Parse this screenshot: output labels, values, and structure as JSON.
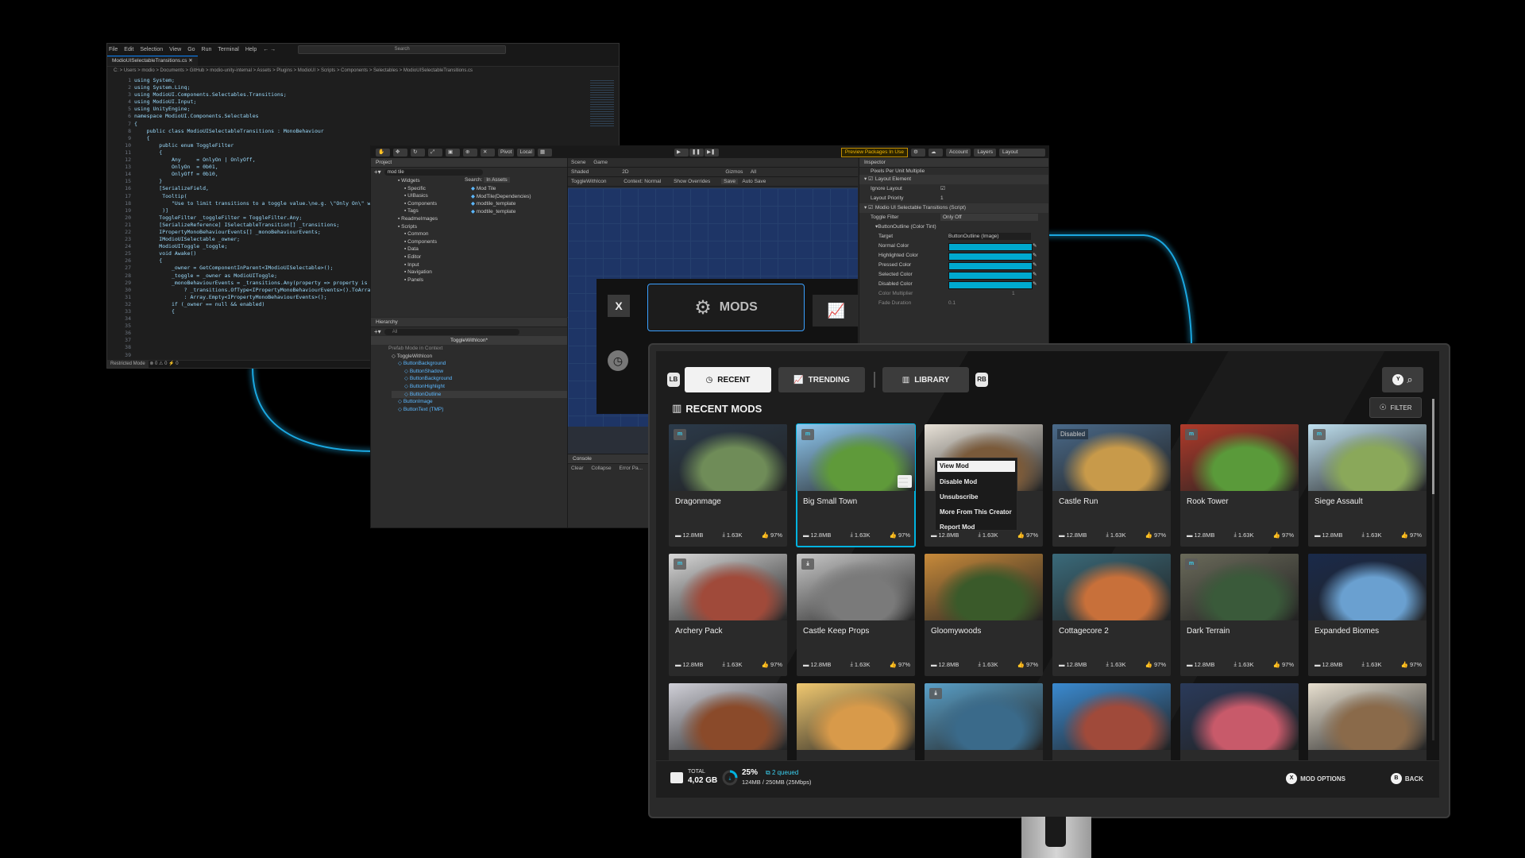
{
  "colors": {
    "glow": "#1aa7e0",
    "accent": "#00b3e0",
    "tile_bg": "#2a2a2a",
    "unity_cyan": "#00a9cf",
    "preview_orange": "#f0b400"
  },
  "code_editor": {
    "menu": [
      "File",
      "Edit",
      "Selection",
      "View",
      "Go",
      "Run",
      "Terminal",
      "Help"
    ],
    "search_placeholder": "Search",
    "tab": "ModioUISelectableTransitions.cs",
    "breadcrumb": "C: > Users > modio > Documents > GitHub > modio-unity-internal > Assets > Plugins > ModioUI > Scripts > Components > Selectables > ModioUISelectableTransitions.cs",
    "lines": [
      "using System;",
      "using System.Linq;",
      "using ModioUI.Components.Selectables.Transitions;",
      "using ModioUI.Input;",
      "using UnityEngine;",
      "",
      "namespace ModioUI.Components.Selectables",
      "{",
      "    public class ModioUISelectableTransitions : MonoBehaviour",
      "    {",
      "        public enum ToggleFilter",
      "        {",
      "            Any     = OnlyOn | OnlyOff,",
      "            OnlyOn  = 0b01,",
      "            OnlyOff = 0b10,",
      "        }",
      "",
      "        [SerializeField,",
      "         Tooltip(",
      "            \"Use to limit transitions to a toggle value.\\ne.g. \\\"Only On\\\" will ...",
      "         )]",
      "        ToggleFilter _toggleFilter = ToggleFilter.Any;",
      "        [SerializeReference] ISelectableTransition[] _transitions;",
      "        IPropertyMonoBehaviourEvents[] _monoBehaviourEvents;",
      "",
      "        IModioUISelectable _owner;",
      "        ModioUIToggle _toggle;",
      "",
      "        void Awake()",
      "        {",
      "            _owner = GetComponentInParent<IModioUISelectable>();",
      "            _toggle = _owner as ModioUIToggle;",
      "",
      "            _monoBehaviourEvents = _transitions.Any(property => property is IProp...",
      "                ? _transitions.OfType<IPropertyMonoBehaviourEvents>().ToArray()",
      "                : Array.Empty<IPropertyMonoBehaviourEvents>();",
      "",
      "            if (_owner == null && enabled)",
      "            {"
    ],
    "status_mode": "Restricted Mode",
    "status_counts": "⊗ 0 ⚠ 0   ⚡ 0"
  },
  "unity": {
    "toolbar": {
      "pivot": "Pivot",
      "local": "Local",
      "preview": "Preview Packages In Use",
      "account": "Account",
      "layers": "Layers",
      "layout": "Layout"
    },
    "project": {
      "title": "Project",
      "search_value": "mod tile",
      "search_label": "Search:",
      "search_scope": "In Assets",
      "tree": [
        "Widgets",
        "Specific",
        "UIBasics",
        "Components",
        "Tags",
        "ReadmeImages",
        "Scripts",
        "Common",
        "Components",
        "Data",
        "Editor",
        "Input",
        "Navigation",
        "Panels"
      ],
      "results": [
        "Mod Tile",
        "ModTile(Dependencies)",
        "modtile_template",
        "modtile_template"
      ]
    },
    "hierarchy": {
      "title": "Hierarchy",
      "search_placeholder": "All",
      "root": "ToggleWithIcon*",
      "context": "Prefab Mode in Context",
      "items": [
        "ToggleWithIcon",
        "ButtonBackground",
        "ButtonShadow",
        "ButtonBackground",
        "ButtonHighlight",
        "ButtonOutline",
        "ButtonImage",
        "ButtonText (TMP)"
      ]
    },
    "scene": {
      "tabs": [
        "Scene",
        "Game"
      ],
      "shading": "Shaded",
      "mode": "2D",
      "context_label": "Context:",
      "context_value": "Normal",
      "show_overrides": "Show Overrides",
      "save": "Save",
      "auto_save": "Auto Save",
      "gizmos": "Gizmos",
      "gizmo_search": "All",
      "prefab_name": "ToggleWithIcon",
      "mods_label": "MODS",
      "x_label": "X",
      "console_title": "Console",
      "console_clear": "Clear",
      "console_collapse": "Collapse",
      "console_error_pause": "Error Pa..."
    },
    "inspector": {
      "title": "Inspector",
      "top_field": "Pixels Per Unit Multiplie",
      "layout_element": "Layout Element",
      "ignore_layout": "Ignore Layout",
      "layout_priority": "Layout Priority",
      "layout_priority_value": "1",
      "script_component": "Modio UI Selectable Transitions (Script)",
      "toggle_filter": "Toggle Filter",
      "toggle_filter_value": "Only Off",
      "color_tint": "ButtonOutline (Color Tint)",
      "target": "Target",
      "target_value": "ButtonOutline (Image)",
      "colors": [
        "Normal Color",
        "Highlighted Color",
        "Pressed Color",
        "Selected Color",
        "Disabled Color"
      ],
      "color_multiplier": "Color Multiplier",
      "color_multiplier_value": "1",
      "fade_duration": "Fade Duration",
      "fade_duration_value": "0.1"
    }
  },
  "mod_browser": {
    "lb": "LB",
    "rb": "RB",
    "tabs": [
      {
        "label": "RECENT",
        "active": true,
        "icon": "clock-icon"
      },
      {
        "label": "TRENDING",
        "active": false,
        "icon": "trend-icon"
      },
      {
        "label": "LIBRARY",
        "active": false,
        "icon": "library-icon"
      }
    ],
    "search_key": "Y",
    "section_title": "RECENT MODS",
    "filter_label": "FILTER",
    "mods": [
      {
        "name": "Dragonmage",
        "size": "12.8MB",
        "downloads": "1.63K",
        "rating": "97%",
        "badge": "subscribed",
        "c1": "#2b3a4a",
        "c2": "#6f8c58"
      },
      {
        "name": "Big Small Town",
        "size": "12.8MB",
        "downloads": "1.63K",
        "rating": "97%",
        "badge": "subscribed",
        "selected": true,
        "c1": "#8fc8f0",
        "c2": "#5f9a3a"
      },
      {
        "name": "",
        "size": "12.8MB",
        "downloads": "1.63K",
        "rating": "97%",
        "badge": "none",
        "c1": "#e8e2d8",
        "c2": "#7a5a3a"
      },
      {
        "name": "Castle Run",
        "size": "12.8MB",
        "downloads": "1.63K",
        "rating": "97%",
        "badge": "disabled",
        "c1": "#4a6a8a",
        "c2": "#c89a4a"
      },
      {
        "name": "Rook Tower",
        "size": "12.8MB",
        "downloads": "1.63K",
        "rating": "97%",
        "badge": "subscribed",
        "c1": "#b03a2a",
        "c2": "#5a9a3a"
      },
      {
        "name": "Siege Assault",
        "size": "12.8MB",
        "downloads": "1.63K",
        "rating": "97%",
        "badge": "subscribed",
        "c1": "#bfe0f0",
        "c2": "#8aa85a"
      },
      {
        "name": "Archery Pack",
        "size": "12.8MB",
        "downloads": "1.63K",
        "rating": "97%",
        "badge": "subscribed",
        "c1": "#d8d8d8",
        "c2": "#a04a3a"
      },
      {
        "name": "Castle Keep Props",
        "size": "12.8MB",
        "downloads": "1.63K",
        "rating": "97%",
        "badge": "download",
        "c1": "#c8c8c8",
        "c2": "#7a7a7a"
      },
      {
        "name": "Gloomywoods",
        "size": "12.8MB",
        "downloads": "1.63K",
        "rating": "97%",
        "badge": "none",
        "c1": "#c88a3a",
        "c2": "#3a5a2a"
      },
      {
        "name": "Cottagecore 2",
        "size": "12.8MB",
        "downloads": "1.63K",
        "rating": "97%",
        "badge": "none",
        "c1": "#3a6a7a",
        "c2": "#c8703a"
      },
      {
        "name": "Dark Terrain",
        "size": "12.8MB",
        "downloads": "1.63K",
        "rating": "97%",
        "badge": "subscribed",
        "c1": "#6a6a5a",
        "c2": "#3a5a3a"
      },
      {
        "name": "Expanded Biomes",
        "size": "12.8MB",
        "downloads": "1.63K",
        "rating": "97%",
        "badge": "none",
        "c1": "#1a2a4a",
        "c2": "#6aa0d0"
      },
      {
        "name": "",
        "size": "",
        "downloads": "",
        "rating": "",
        "badge": "none",
        "c1": "#d0d0d8",
        "c2": "#8a4a2a"
      },
      {
        "name": "",
        "size": "",
        "downloads": "",
        "rating": "",
        "badge": "none",
        "c1": "#f0c870",
        "c2": "#d89a4a"
      },
      {
        "name": "",
        "size": "",
        "downloads": "",
        "rating": "",
        "badge": "download",
        "c1": "#5aa0c8",
        "c2": "#3a6a8a"
      },
      {
        "name": "",
        "size": "",
        "downloads": "",
        "rating": "",
        "badge": "none",
        "c1": "#3a8ad0",
        "c2": "#a04a3a"
      },
      {
        "name": "",
        "size": "",
        "downloads": "",
        "rating": "",
        "badge": "none",
        "c1": "#2a3a5a",
        "c2": "#c85a6a"
      },
      {
        "name": "",
        "size": "",
        "downloads": "",
        "rating": "",
        "badge": "none",
        "c1": "#e8e0d0",
        "c2": "#8a6a4a"
      }
    ],
    "context_menu": [
      "View Mod",
      "Disable Mod",
      "Unsubscribe",
      "More From This Creator",
      "Report Mod"
    ],
    "status": {
      "total_label": "TOTAL",
      "total_value": "4,02 GB",
      "progress_percent": "25%",
      "progress": 0.25,
      "queued": "2 queued",
      "transfer": "124MB / 250MB (25Mbps)"
    },
    "actions": [
      {
        "key": "X",
        "label": "MOD OPTIONS"
      },
      {
        "key": "B",
        "label": "BACK"
      }
    ]
  }
}
